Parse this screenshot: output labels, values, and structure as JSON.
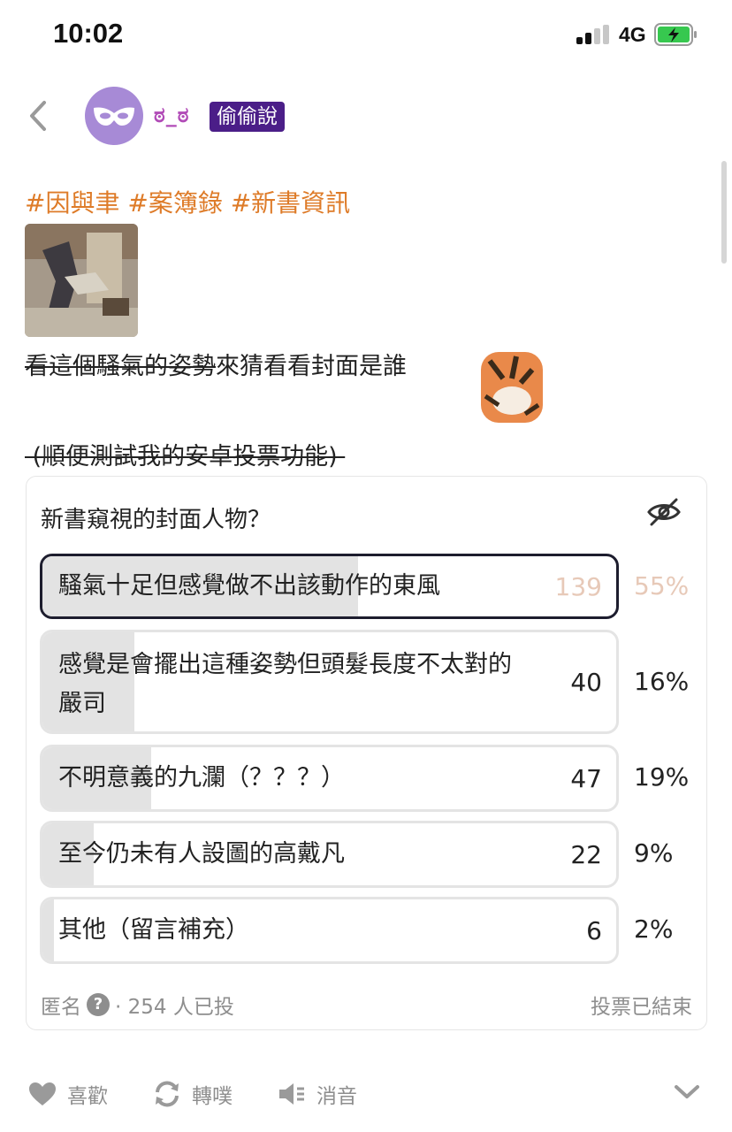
{
  "status_bar": {
    "time": "10:02",
    "network": "4G"
  },
  "header": {
    "author_name": "ಠ_ಠ",
    "badge": "偷偷說",
    "avatar_icon": "mask-icon"
  },
  "post": {
    "tags": "#因與聿 #案簿錄 #新書資訊",
    "line1_strike": "看這個騷氣的姿勢",
    "line1_rest": "來猜看看封面是誰",
    "line2": " (順便測試我的安卓投票功能) "
  },
  "poll": {
    "question": "新書窺視的封面人物？",
    "options": [
      {
        "label": "騷氣十足但感覺做不出該動作的東風",
        "count": "139",
        "percent": "55%",
        "fill": 0.55,
        "selected": true
      },
      {
        "label": "感覺是會擺出這種姿勢但頭髮長度不太對的嚴司",
        "count": "40",
        "percent": "16%",
        "fill": 0.16,
        "selected": false
      },
      {
        "label": "不明意義的九瀾（？？？）",
        "count": "47",
        "percent": "19%",
        "fill": 0.19,
        "selected": false
      },
      {
        "label": "至今仍未有人設圖的高戴凡",
        "count": "22",
        "percent": "9%",
        "fill": 0.09,
        "selected": false
      },
      {
        "label": "其他（留言補充）",
        "count": "6",
        "percent": "2%",
        "fill": 0.02,
        "selected": false
      }
    ],
    "anonymous_label": "匿名",
    "voters": "· 254 人已投",
    "status": "投票已結束"
  },
  "actions": {
    "like": "喜歡",
    "repost": "轉噗",
    "mute": "消音"
  },
  "colors": {
    "tag": "#de7b28",
    "badge_bg": "#4b1e88",
    "author": "#b14bb7",
    "selected_border": "#1d1d2e",
    "selected_count": "#e7c9b8"
  }
}
